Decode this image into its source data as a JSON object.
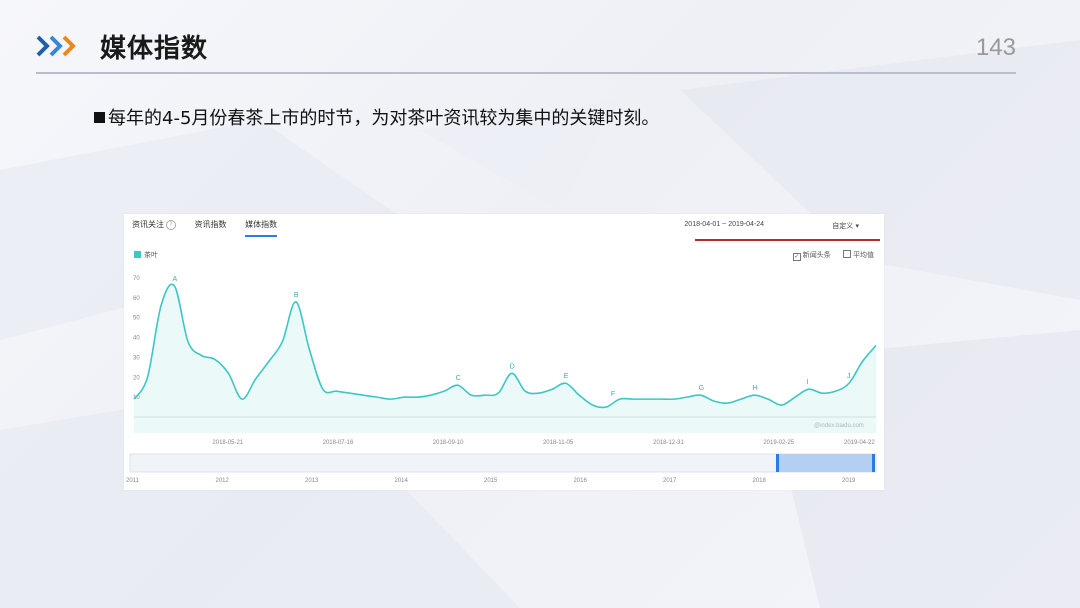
{
  "slide": {
    "title": "媒体指数",
    "page_number": "143",
    "bullet": "每年的4-5月份春茶上市的时节，为对茶叶资讯较为集中的关键时刻。"
  },
  "panel": {
    "tabs": [
      "资讯关注",
      "资讯指数",
      "媒体指数"
    ],
    "active_tab": "媒体指数",
    "date_range": "2018-04-01 ~ 2019-04-24",
    "custom_label": "自定义",
    "legend_label": "茶叶",
    "option_news": "新闻头条",
    "option_avg": "平均值",
    "watermark": "@index.baidu.com"
  },
  "colors": {
    "series": "#3dc7c4",
    "accent": "#2a7be4",
    "underline": "#b02a30"
  },
  "chart_data": {
    "type": "area",
    "series_name": "茶叶",
    "ylim": [
      0,
      70
    ],
    "y_ticks": [
      "70",
      "60",
      "50",
      "40",
      "30",
      "20",
      "10"
    ],
    "x_tick_labels": [
      "2018-05-21",
      "2018-07-16",
      "2018-09-10",
      "2018-11-05",
      "2018-12-31",
      "2019-02-25",
      "2019-04-22"
    ],
    "x_range_weeks": [
      0,
      55
    ],
    "values_by_week": [
      [
        0,
        9
      ],
      [
        1,
        20
      ],
      [
        2,
        56
      ],
      [
        3,
        66
      ],
      [
        4,
        38
      ],
      [
        5,
        31
      ],
      [
        6,
        29
      ],
      [
        7,
        22
      ],
      [
        8,
        9
      ],
      [
        9,
        19
      ],
      [
        10,
        28
      ],
      [
        11,
        38
      ],
      [
        12,
        58
      ],
      [
        13,
        34
      ],
      [
        14,
        14
      ],
      [
        15,
        13
      ],
      [
        16,
        12
      ],
      [
        17,
        11
      ],
      [
        18,
        10
      ],
      [
        19,
        9
      ],
      [
        20,
        10
      ],
      [
        21,
        10
      ],
      [
        22,
        11
      ],
      [
        23,
        13
      ],
      [
        24,
        16
      ],
      [
        25,
        11
      ],
      [
        26,
        11
      ],
      [
        27,
        12
      ],
      [
        28,
        22
      ],
      [
        29,
        13
      ],
      [
        30,
        12
      ],
      [
        31,
        14
      ],
      [
        32,
        17
      ],
      [
        33,
        11
      ],
      [
        34,
        6
      ],
      [
        35,
        5
      ],
      [
        36,
        9
      ],
      [
        37,
        9
      ],
      [
        38,
        9
      ],
      [
        39,
        9
      ],
      [
        40,
        9
      ],
      [
        41,
        10
      ],
      [
        42,
        11
      ],
      [
        43,
        8
      ],
      [
        44,
        7
      ],
      [
        45,
        9
      ],
      [
        46,
        11
      ],
      [
        47,
        9
      ],
      [
        48,
        6
      ],
      [
        49,
        10
      ],
      [
        50,
        14
      ],
      [
        51,
        12
      ],
      [
        52,
        13
      ],
      [
        53,
        17
      ],
      [
        54,
        28
      ],
      [
        55,
        36
      ]
    ],
    "annotations": [
      {
        "label": "A",
        "week": 3,
        "value": 66
      },
      {
        "label": "B",
        "week": 12,
        "value": 58
      },
      {
        "label": "C",
        "week": 24,
        "value": 16
      },
      {
        "label": "D",
        "week": 28,
        "value": 22
      },
      {
        "label": "E",
        "week": 32,
        "value": 17
      },
      {
        "label": "F",
        "week": 35.5,
        "value": 8
      },
      {
        "label": "G",
        "week": 42,
        "value": 11
      },
      {
        "label": "H",
        "week": 46,
        "value": 11
      },
      {
        "label": "I",
        "week": 50,
        "value": 14
      },
      {
        "label": "J",
        "week": 53,
        "value": 17
      }
    ],
    "navigator_years": [
      "2011",
      "2012",
      "2013",
      "2014",
      "2015",
      "2016",
      "2017",
      "2018",
      "2019"
    ],
    "grid": false
  }
}
